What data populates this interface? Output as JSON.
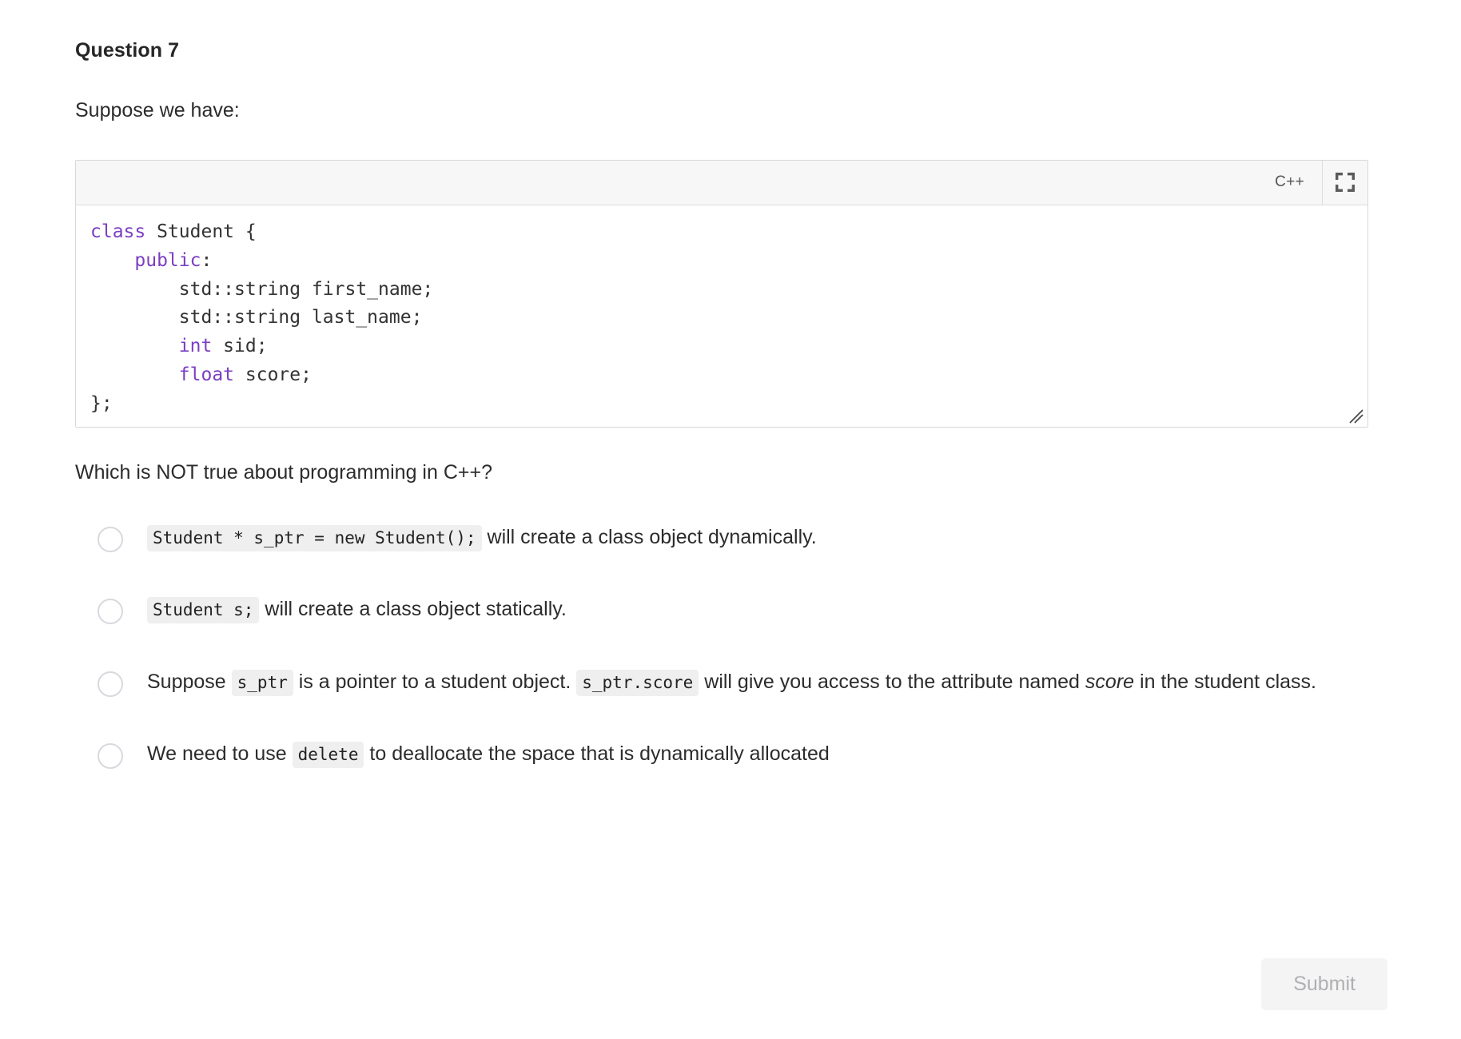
{
  "question": {
    "title": "Question 7",
    "prompt": "Suppose we have:",
    "text": "Which is NOT true about programming in C++?"
  },
  "code_block": {
    "language_label": "C++",
    "expand_icon": "fullscreen-expand-icon",
    "resize_icon": "resize-grip-icon",
    "lines": [
      {
        "indent": "",
        "segments": [
          {
            "t": "class",
            "kw": true
          },
          {
            "t": " Student {",
            "kw": false
          }
        ]
      },
      {
        "indent": "    ",
        "segments": [
          {
            "t": "public",
            "kw": true
          },
          {
            "t": ":",
            "kw": false
          }
        ]
      },
      {
        "indent": "        ",
        "segments": [
          {
            "t": "std::string first_name;",
            "kw": false
          }
        ]
      },
      {
        "indent": "        ",
        "segments": [
          {
            "t": "std::string last_name;",
            "kw": false
          }
        ]
      },
      {
        "indent": "        ",
        "segments": [
          {
            "t": "int",
            "kw": true
          },
          {
            "t": " sid;",
            "kw": false
          }
        ]
      },
      {
        "indent": "        ",
        "segments": [
          {
            "t": "float",
            "kw": true
          },
          {
            "t": " score;",
            "kw": false
          }
        ]
      },
      {
        "indent": "",
        "segments": [
          {
            "t": "};",
            "kw": false
          }
        ]
      }
    ],
    "plain_text": "class Student {\n    public:\n        std::string first_name;\n        std::string last_name;\n        int sid;\n        float score;\n};"
  },
  "options": [
    {
      "id": "option-1",
      "selected": false,
      "parts": [
        {
          "type": "code",
          "text": "Student * s_ptr = new Student();"
        },
        {
          "type": "text",
          "text": " will create a class object dynamically."
        }
      ]
    },
    {
      "id": "option-2",
      "selected": false,
      "parts": [
        {
          "type": "code",
          "text": "Student s;"
        },
        {
          "type": "text",
          "text": " will create a class object statically."
        }
      ]
    },
    {
      "id": "option-3",
      "selected": false,
      "parts": [
        {
          "type": "text",
          "text": "Suppose "
        },
        {
          "type": "code",
          "text": "s_ptr"
        },
        {
          "type": "text",
          "text": " is a pointer to a student object. "
        },
        {
          "type": "code",
          "text": "s_ptr.score"
        },
        {
          "type": "text",
          "text": " will give you access to the attribute named "
        },
        {
          "type": "italic",
          "text": "score"
        },
        {
          "type": "text",
          "text": " in the student class."
        }
      ]
    },
    {
      "id": "option-4",
      "selected": false,
      "parts": [
        {
          "type": "text",
          "text": "We need to use "
        },
        {
          "type": "code",
          "text": "delete"
        },
        {
          "type": "text",
          "text": " to deallocate the space that is dynamically allocated"
        }
      ]
    }
  ],
  "submit": {
    "label": "Submit",
    "disabled": true
  },
  "colors": {
    "keyword_purple": "#7b3fc2",
    "inline_code_bg": "#efefef",
    "toolbar_bg": "#f7f7f7",
    "border": "#d8d8d8",
    "radio_border": "#d7d9de",
    "submit_bg": "#f4f4f5",
    "submit_text": "#b0b0b3",
    "body_text": "#2c2c2c"
  }
}
